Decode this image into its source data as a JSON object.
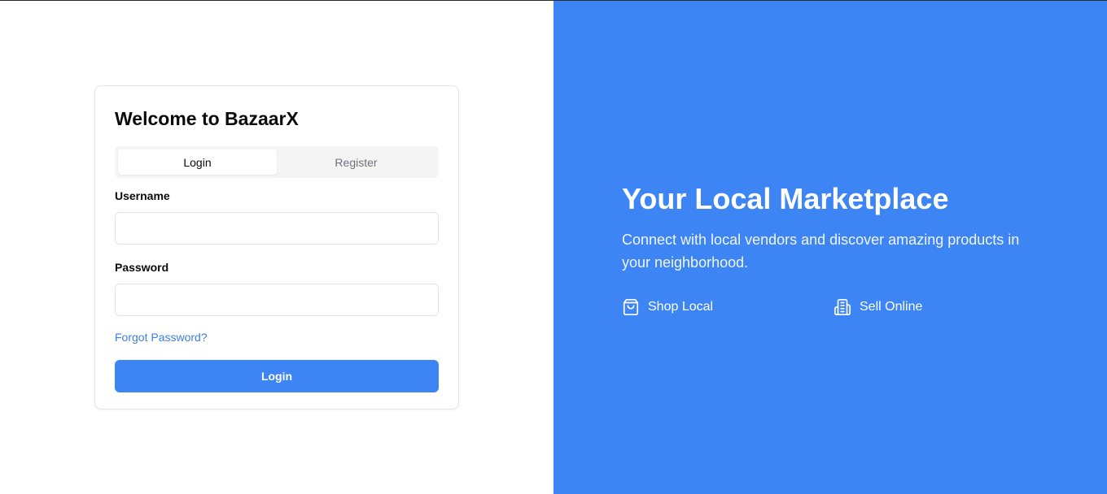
{
  "login_card": {
    "title": "Welcome to BazaarX",
    "tabs": [
      {
        "label": "Login",
        "active": true
      },
      {
        "label": "Register",
        "active": false
      }
    ],
    "username": {
      "label": "Username",
      "value": "",
      "placeholder": ""
    },
    "password": {
      "label": "Password",
      "value": "",
      "placeholder": ""
    },
    "forgot_password": "Forgot Password?",
    "submit_label": "Login"
  },
  "hero": {
    "title": "Your Local Marketplace",
    "subtitle": "Connect with local vendors and discover amazing products in your neighborhood.",
    "features": [
      {
        "icon": "shopping-bag-icon",
        "label": "Shop Local"
      },
      {
        "icon": "storefront-receipt-icon",
        "label": "Sell Online"
      }
    ]
  },
  "colors": {
    "accent": "#3d85f5",
    "link": "#3d7fe0",
    "border": "#e4e4e7",
    "tab_bg": "#f4f4f5"
  }
}
